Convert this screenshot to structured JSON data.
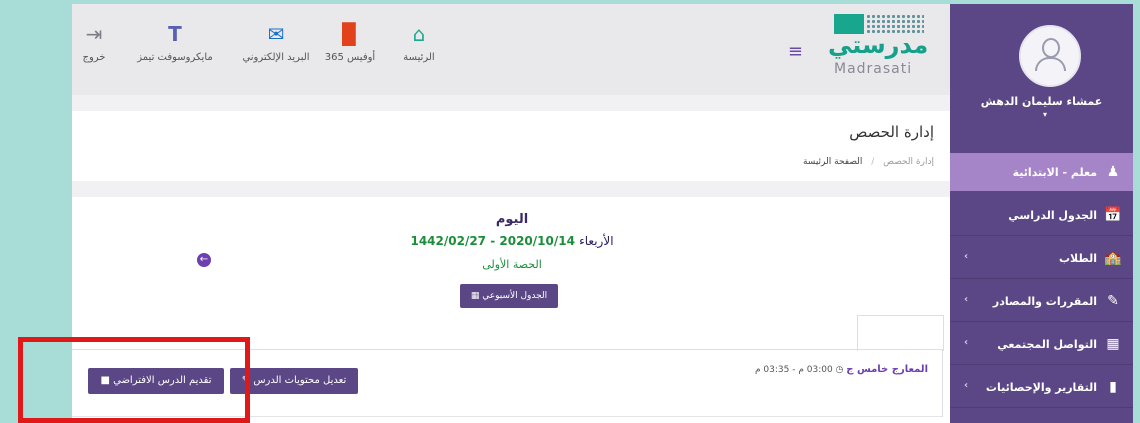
{
  "sidebar": {
    "user_name": "عمشاء سليمان الدهش",
    "caret": "▾",
    "role_label": "معلم - الابتدائية",
    "items": [
      {
        "label": "الجدول الدراسي",
        "icon": "calendar-clock-icon",
        "glyph": "📅",
        "chevron": ""
      },
      {
        "label": "الطلاب",
        "icon": "students-icon",
        "glyph": "🏫",
        "chevron": "‹"
      },
      {
        "label": "المقررات والمصادر",
        "icon": "edit-book-icon",
        "glyph": "✎",
        "chevron": "‹"
      },
      {
        "label": "التواصل المجتمعي",
        "icon": "community-icon",
        "glyph": "▦",
        "chevron": "‹"
      },
      {
        "label": "التقارير والإحصائيات",
        "icon": "bar-chart-icon",
        "glyph": "▮",
        "chevron": "‹"
      }
    ]
  },
  "header": {
    "logo_ar": "مدرستي",
    "logo_en": "Madrasati",
    "menu_glyph": "≡",
    "nav": [
      {
        "label": "الرئيسة",
        "icon": "home-icon",
        "glyph": "⌂",
        "color": "#1aa88f"
      },
      {
        "label": "أوفيس 365",
        "icon": "office-icon",
        "glyph": "▉",
        "color": "#e2421b"
      },
      {
        "label": "البريد الإلكتروني",
        "icon": "outlook-icon",
        "glyph": "✉",
        "color": "#1b6fc9"
      },
      {
        "label": "مايكروسوفت تيمز",
        "icon": "teams-icon",
        "glyph": "T",
        "color": "#5a5fb5"
      },
      {
        "label": "خروج",
        "icon": "logout-icon",
        "glyph": "⇥",
        "color": "#7d7d86"
      }
    ]
  },
  "page": {
    "title": "إدارة الحصص",
    "breadcrumb_home": "الصفحة الرئيسة",
    "breadcrumb_sep": "/",
    "breadcrumb_current": "إدارة الحصص"
  },
  "schedule": {
    "today_label": "اليوم",
    "day_name": "الأربعاء",
    "date": "1442/02/27 - 2020/10/14",
    "period": "الحصة الأولى",
    "weekly_button": "الجدول الأسبوعي",
    "back_glyph": "←"
  },
  "session": {
    "class_name": "المعارج خامس ج",
    "time": "03:00 م - 03:35 م",
    "edit_button": "تعديل محتويات الدرس",
    "virtual_button": "تقديم الدرس الافتراضي"
  },
  "colors": {
    "sidebar": "#5b4785",
    "active": "#a585c7",
    "accent": "#17a08a",
    "highlight": "#e01818"
  }
}
